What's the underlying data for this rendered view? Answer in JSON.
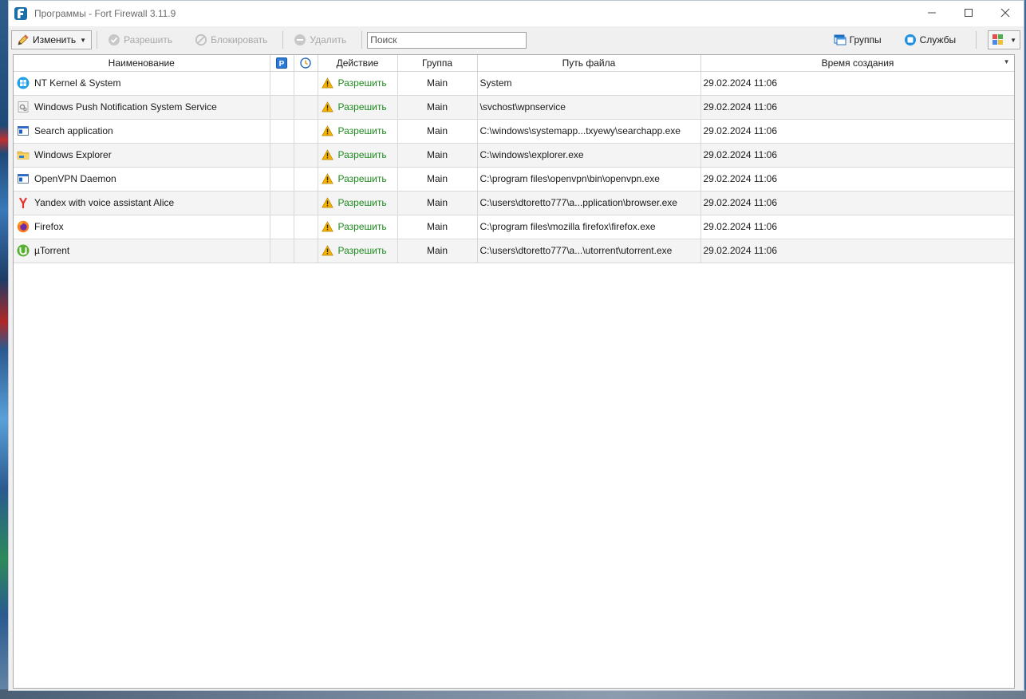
{
  "window": {
    "title": "Программы - Fort Firewall 3.11.9"
  },
  "toolbar": {
    "edit_label": "Изменить",
    "allow_label": "Разрешить",
    "block_label": "Блокировать",
    "delete_label": "Удалить",
    "search_placeholder": "Поиск",
    "groups_label": "Группы",
    "services_label": "Службы"
  },
  "table": {
    "columns": [
      "Наименование",
      "",
      "",
      "Действие",
      "Группа",
      "Путь файла",
      "Время создания"
    ],
    "rows": [
      {
        "name": "NT Kernel & System",
        "icon": "windows-icon",
        "action": "Разрешить",
        "group": "Main",
        "path": "System",
        "created": "29.02.2024 11:06"
      },
      {
        "name": "Windows Push Notification System Service",
        "icon": "service-icon",
        "action": "Разрешить",
        "group": "Main",
        "path": "\\svchost\\wpnservice",
        "created": "29.02.2024 11:06"
      },
      {
        "name": "Search application",
        "icon": "app-window-icon",
        "action": "Разрешить",
        "group": "Main",
        "path": "C:\\windows\\systemapp...txyewy\\searchapp.exe",
        "created": "29.02.2024 11:06"
      },
      {
        "name": "Windows Explorer",
        "icon": "folder-icon",
        "action": "Разрешить",
        "group": "Main",
        "path": "C:\\windows\\explorer.exe",
        "created": "29.02.2024 11:06"
      },
      {
        "name": "OpenVPN Daemon",
        "icon": "app-window-icon",
        "action": "Разрешить",
        "group": "Main",
        "path": "C:\\program files\\openvpn\\bin\\openvpn.exe",
        "created": "29.02.2024 11:06"
      },
      {
        "name": "Yandex with voice assistant Alice",
        "icon": "yandex-icon",
        "action": "Разрешить",
        "group": "Main",
        "path": "C:\\users\\dtoretto777\\a...pplication\\browser.exe",
        "created": "29.02.2024 11:06"
      },
      {
        "name": "Firefox",
        "icon": "firefox-icon",
        "action": "Разрешить",
        "group": "Main",
        "path": "C:\\program files\\mozilla firefox\\firefox.exe",
        "created": "29.02.2024 11:06"
      },
      {
        "name": "µTorrent",
        "icon": "utorrent-icon",
        "action": "Разрешить",
        "group": "Main",
        "path": "C:\\users\\dtoretto777\\a...\\utorrent\\utorrent.exe",
        "created": "29.02.2024 11:06"
      }
    ]
  },
  "colors": {
    "allow_text": "#1e8a1e",
    "warning": "#f5b400",
    "accent": "#1f8fe0"
  }
}
